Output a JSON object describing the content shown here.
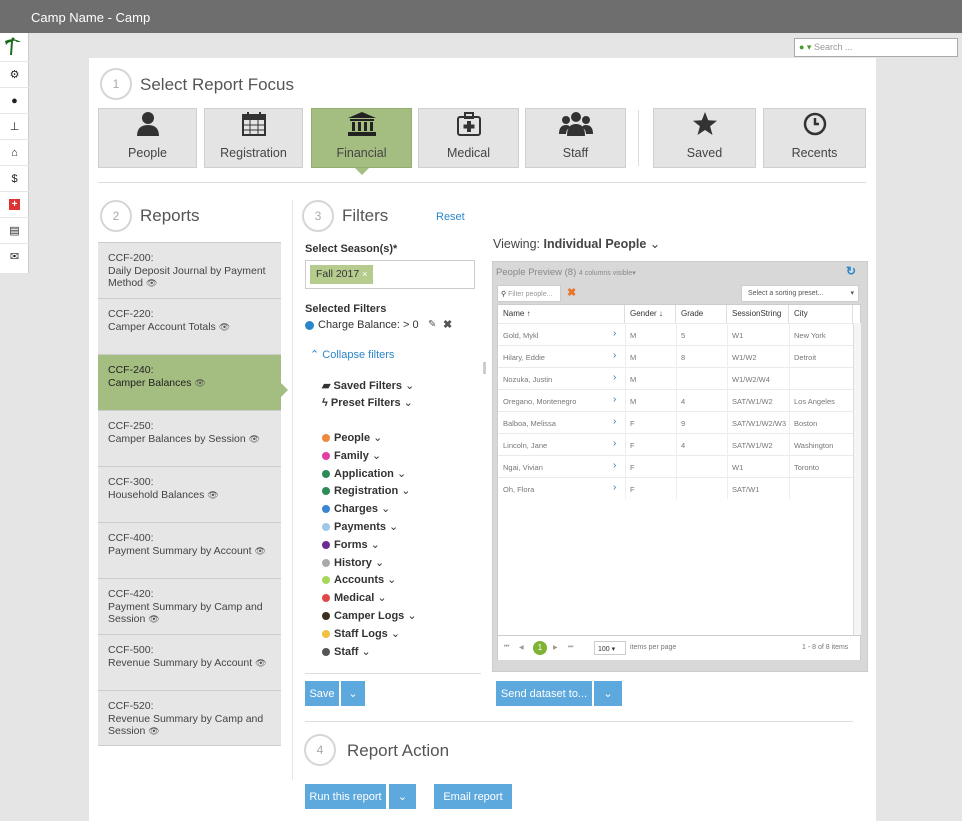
{
  "app_title": "Camp Name - Camp",
  "search_placeholder": "Search ...",
  "focus": {
    "step": "1",
    "title": "Select Report Focus",
    "buttons": [
      {
        "label": "People",
        "icon": "person-icon",
        "active": false
      },
      {
        "label": "Registration",
        "icon": "calendar-icon",
        "active": false
      },
      {
        "label": "Financial",
        "icon": "bank-icon",
        "active": true
      },
      {
        "label": "Medical",
        "icon": "medkit-icon",
        "active": false
      },
      {
        "label": "Staff",
        "icon": "group-icon",
        "active": false
      },
      {
        "label": "Saved",
        "icon": "star-icon",
        "active": false
      },
      {
        "label": "Recents",
        "icon": "clock-icon",
        "active": false
      }
    ]
  },
  "reports": {
    "step": "2",
    "title": "Reports",
    "items": [
      {
        "code": "CCF-200:",
        "name": "Daily Deposit Journal by Payment Method",
        "active": false
      },
      {
        "code": "CCF-220:",
        "name": "Camper Account Totals",
        "active": false
      },
      {
        "code": "CCF-240:",
        "name": "Camper Balances",
        "active": true
      },
      {
        "code": "CCF-250:",
        "name": "Camper Balances by Session",
        "active": false
      },
      {
        "code": "CCF-300:",
        "name": "Household Balances",
        "active": false
      },
      {
        "code": "CCF-400:",
        "name": "Payment Summary by Account",
        "active": false
      },
      {
        "code": "CCF-420:",
        "name": "Payment Summary by Camp and Session",
        "active": false
      },
      {
        "code": "CCF-500:",
        "name": "Revenue Summary by Account",
        "active": false
      },
      {
        "code": "CCF-520:",
        "name": "Revenue Summary by Camp and Session",
        "active": false
      }
    ]
  },
  "filters": {
    "step": "3",
    "title": "Filters",
    "reset": "Reset",
    "season_label": "Select Season(s)*",
    "season_chip": "Fall 2017",
    "selected_label": "Selected Filters",
    "selected_filter": "Charge Balance: > 0",
    "collapse": "Collapse filters",
    "saved_filters": "Saved Filters",
    "preset_filters": "Preset Filters",
    "categories": [
      {
        "label": "People",
        "color": "#f0883e"
      },
      {
        "label": "Family",
        "color": "#e040a0"
      },
      {
        "label": "Application",
        "color": "#2e8b57"
      },
      {
        "label": "Registration",
        "color": "#2e8b57"
      },
      {
        "label": "Charges",
        "color": "#3a86d4"
      },
      {
        "label": "Payments",
        "color": "#9ec7e8"
      },
      {
        "label": "Forms",
        "color": "#6a2c91"
      },
      {
        "label": "History",
        "color": "#aaaaaa"
      },
      {
        "label": "Accounts",
        "color": "#a6d75b"
      },
      {
        "label": "Medical",
        "color": "#e04848"
      },
      {
        "label": "Camper Logs",
        "color": "#3a2e1e"
      },
      {
        "label": "Staff Logs",
        "color": "#f0c040"
      },
      {
        "label": "Staff",
        "color": "#555555"
      }
    ],
    "save": "Save"
  },
  "viewing": {
    "prefix": "Viewing:",
    "value": "Individual People"
  },
  "preview": {
    "title": "People Preview (8)",
    "cols_visible": "4 columns visible",
    "filter_placeholder": "Filter people...",
    "sort_placeholder": "Select a sorting preset...",
    "headers": [
      "Name ↑",
      "Gender ↓",
      "Grade",
      "SessionString",
      "City"
    ],
    "rows": [
      [
        "Gold, Mykl",
        "M",
        "5",
        "W1",
        "New York"
      ],
      [
        "Hilary, Eddie",
        "M",
        "8",
        "W1/W2",
        "Detroit"
      ],
      [
        "Nozuka, Justin",
        "M",
        "",
        "W1/W2/W4",
        ""
      ],
      [
        "Oregano, Montenegro",
        "M",
        "4",
        "SAT/W1/W2",
        "Los Angeles"
      ],
      [
        "Balboa, Melissa",
        "F",
        "9",
        "SAT/W1/W2/W3",
        "Boston"
      ],
      [
        "Lincoln, Jane",
        "F",
        "4",
        "SAT/W1/W2",
        "Washington"
      ],
      [
        "Ngai, Vivian",
        "F",
        "",
        "W1",
        "Toronto"
      ],
      [
        "Oh, Flora",
        "F",
        "",
        "SAT/W1",
        ""
      ]
    ],
    "page": "1",
    "page_size": "100",
    "per_page": "items per page",
    "count": "1 - 8 of 8 items",
    "send": "Send dataset to..."
  },
  "action": {
    "step": "4",
    "title": "Report Action",
    "run": "Run this report",
    "email": "Email report"
  }
}
